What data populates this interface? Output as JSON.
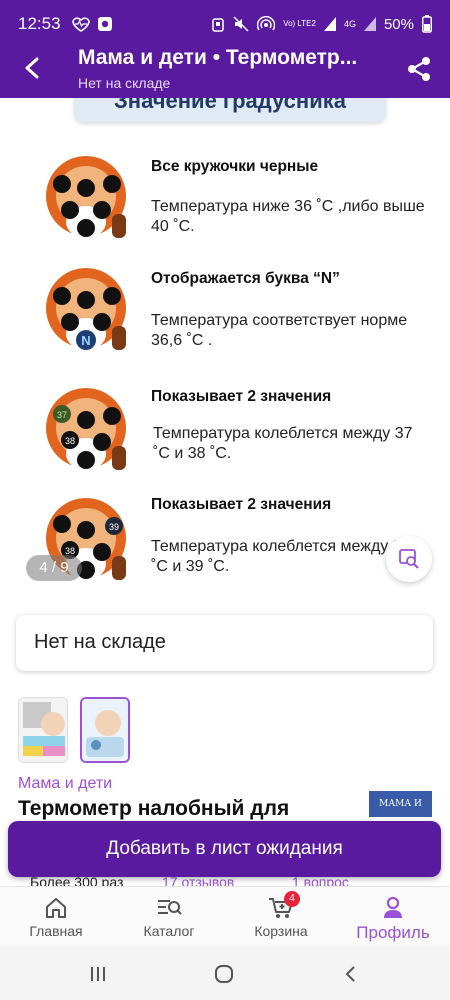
{
  "status_bar": {
    "time": "12:53",
    "network": "Vo) LTE2",
    "network_gen": "4G",
    "battery": "50%"
  },
  "app_bar": {
    "title": "Мама и дети • Термометр...",
    "subtitle": "Нет на складе"
  },
  "hero": {
    "banner": "Значение градусника",
    "rows": [
      {
        "heading": "Все кружочки черные",
        "desc": "Температура ниже 36 ˚С ,либо выше 40 ˚С.",
        "face_label": ""
      },
      {
        "heading": "Отображается буква “N”",
        "desc": "Температура соответствует норме 36,6 ˚С .",
        "face_label": "N"
      },
      {
        "heading": "Показывает 2 значения",
        "desc": "Температура колеблется между 37 ˚С и 38 ˚С.",
        "face_label_a": "37",
        "face_label_b": "38"
      },
      {
        "heading": "Показывает 2 значения",
        "desc": "Температура колеблется между 38 ˚С и 39 ˚С.",
        "face_label_a": "39",
        "face_label_b": "38"
      }
    ],
    "pager": "4 / 9"
  },
  "stock_card": {
    "text": "Нет на складе"
  },
  "product": {
    "brand": "Мама и дети",
    "brand_logo_text": "МАМА И ДЕТИ",
    "title": "Термометр налобный для",
    "cta_label": "Добавить в лист ожидания",
    "stats": [
      "Более 300 раз",
      "17 отзывов",
      "1 вопрос"
    ]
  },
  "tabs": [
    {
      "label": "Главная",
      "icon": "home-icon"
    },
    {
      "label": "Каталог",
      "icon": "catalog-search-icon"
    },
    {
      "label": "Корзина",
      "icon": "cart-icon",
      "badge": "4"
    },
    {
      "label": "Профиль",
      "icon": "profile-icon",
      "active": true
    }
  ],
  "colors": {
    "brand_purple": "#5a1aa0",
    "accent_purple": "#9b52d8",
    "badge_red": "#e8233b"
  }
}
